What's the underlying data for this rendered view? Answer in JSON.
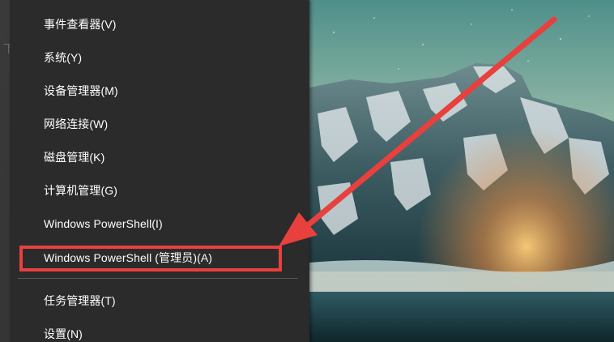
{
  "menu": {
    "items": [
      {
        "label": "事件查看器(V)"
      },
      {
        "label": "系统(Y)"
      },
      {
        "label": "设备管理器(M)"
      },
      {
        "label": "网络连接(W)"
      },
      {
        "label": "磁盘管理(K)"
      },
      {
        "label": "计算机管理(G)"
      },
      {
        "label": "Windows PowerShell(I)"
      },
      {
        "label": "Windows PowerShell (管理员)(A)"
      },
      {
        "label": "任务管理器(T)"
      },
      {
        "label": "设置(N)"
      }
    ],
    "highlighted_item": "Windows PowerShell (管理员)(A)"
  },
  "behind_window": {
    "glyph": "下"
  },
  "colors": {
    "menu_background": "#2b2b2b",
    "menu_text": "#ffffff",
    "separator": "#575757",
    "annotation_red": "#e8403d"
  }
}
